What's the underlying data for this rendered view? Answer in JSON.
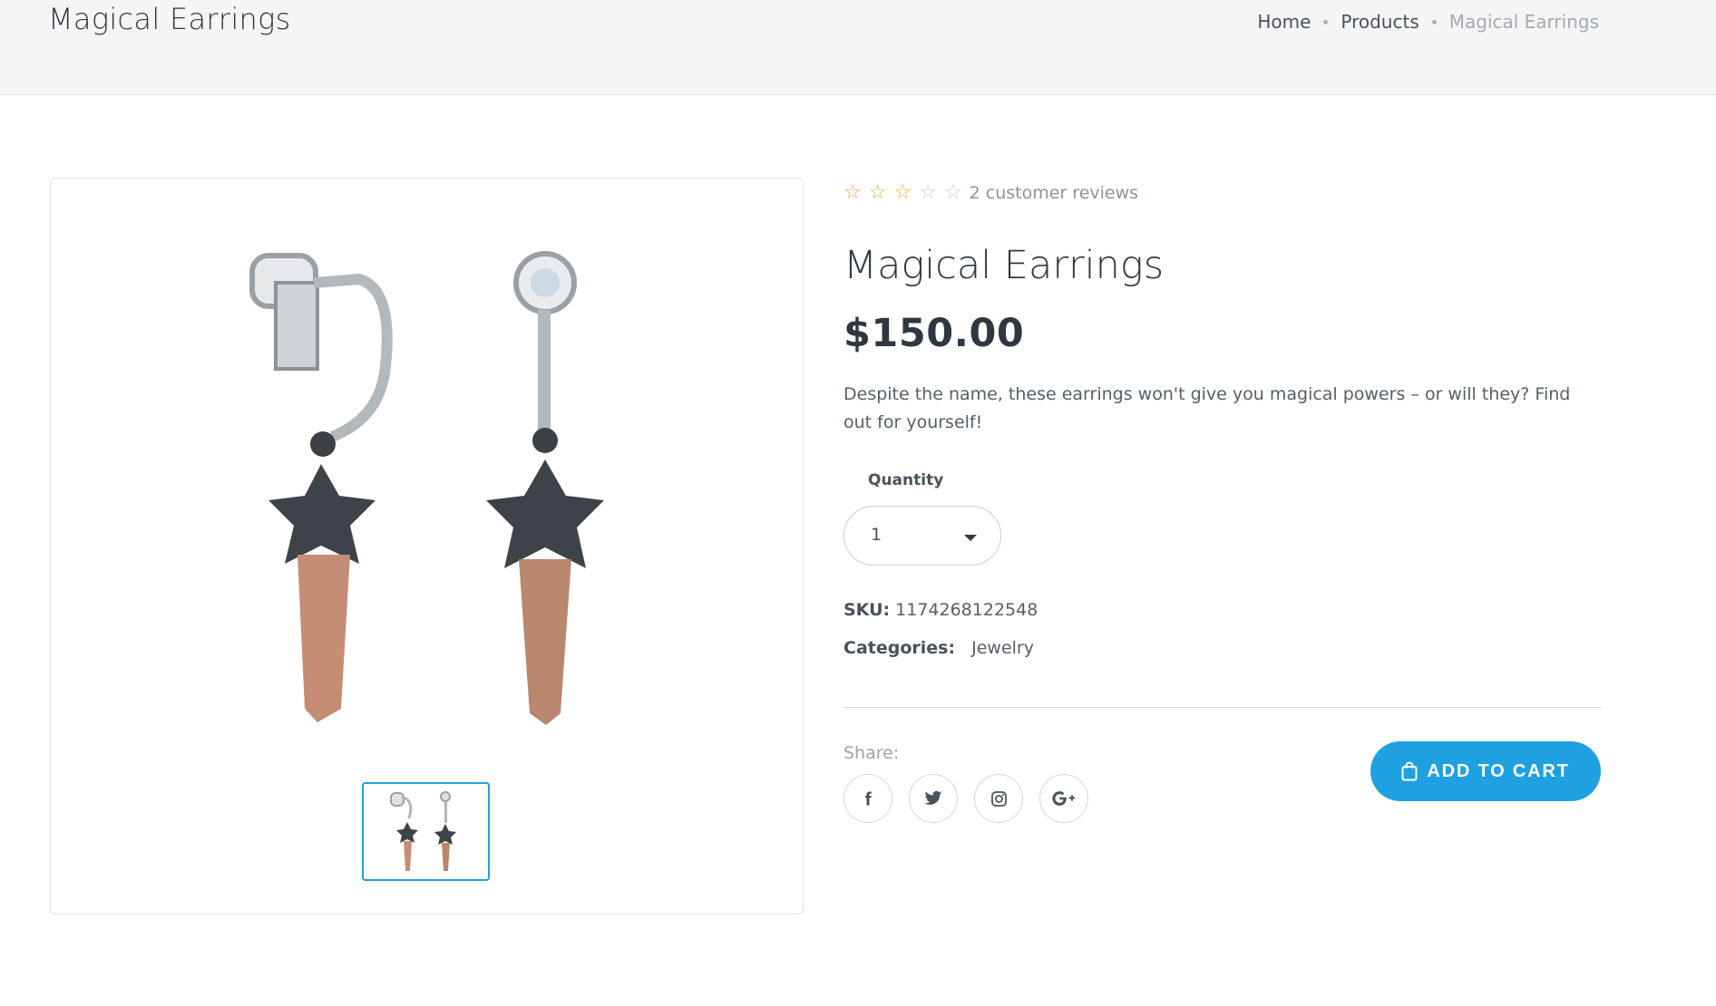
{
  "header": {
    "title": "Magical Earrings",
    "breadcrumb": [
      {
        "label": "Home"
      },
      {
        "label": "Products"
      },
      {
        "label": "Magical Earrings"
      }
    ]
  },
  "product": {
    "rating": 3,
    "rating_max": 5,
    "reviews_text": "2 customer reviews",
    "title": "Magical Earrings",
    "price": "$150.00",
    "description": "Despite the name, these earrings won't give you magical powers – or will they? Find out for yourself!",
    "quantity_label": "Quantity",
    "quantity_value": "1",
    "sku_label": "SKU:",
    "sku_value": "1174268122548",
    "categories_label": "Categories:",
    "category": "Jewelry",
    "share_label": "Share:",
    "socials": [
      "facebook-icon",
      "twitter-icon",
      "instagram-icon",
      "google-plus-icon"
    ],
    "add_to_cart_label": "ADD TO CART"
  },
  "colors": {
    "accent": "#1ea0e1",
    "star": "#f0a93a",
    "text": "#2f3842"
  }
}
